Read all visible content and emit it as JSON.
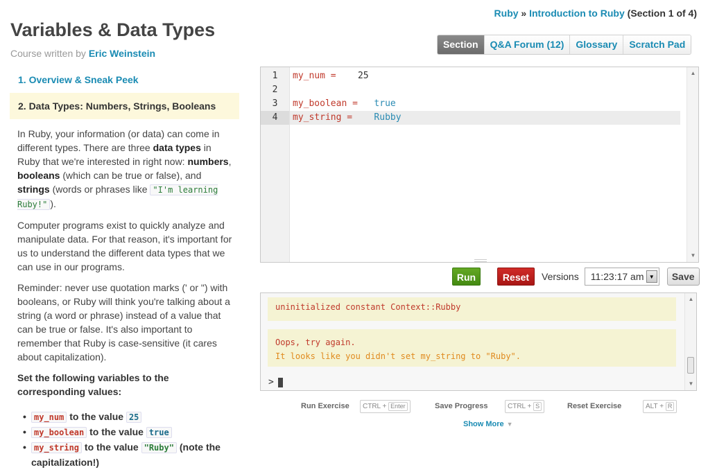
{
  "breadcrumb": {
    "course": "Ruby",
    "sep": " » ",
    "lesson": "Introduction to Ruby",
    "section": " (Section 1 of 4)"
  },
  "page": {
    "title": "Variables & Data Types",
    "author_prefix": "Course written by ",
    "author": "Eric Weinstein"
  },
  "tabs": [
    {
      "label": "Section"
    },
    {
      "label": "Q&A Forum (12)"
    },
    {
      "label": "Glossary"
    },
    {
      "label": "Scratch Pad"
    }
  ],
  "sections": {
    "one": "1. Overview & Sneak Peek",
    "two": "2. Data Types: Numbers, Strings, Booleans"
  },
  "instructions": {
    "p1": {
      "a": "In Ruby, your information (or data) can come in different types. There are three ",
      "b": "data types",
      "c": " in Ruby that we're interested in right now: ",
      "d": "numbers",
      "e": ", ",
      "f": "booleans",
      "g": " (which can be true or false), and ",
      "h": "strings",
      "i": " (words or phrases like ",
      "code": "\"I'm learning Ruby!\"",
      "j": ")."
    },
    "p2": "Computer programs exist to quickly analyze and manipulate data. For that reason, it's important for us to understand the different data types that we can use in our programs.",
    "p3": "Reminder: never use quotation marks (' or \") with booleans, or Ruby will think you're talking about a string (a word or phrase) instead of a value that can be true or false. It's also important to remember that Ruby is case-sensitive (it cares about capitalization).",
    "task": "Set the following variables to the corresponding values:",
    "items": [
      {
        "var": "my_num",
        "mid": " to the value ",
        "val": "25",
        "tail": ""
      },
      {
        "var": "my_boolean",
        "mid": " to the value ",
        "val": "true",
        "tail": ""
      },
      {
        "var": "my_string",
        "mid": " to the value ",
        "val": "\"Ruby\"",
        "tail": " (note the capitalization!)"
      }
    ]
  },
  "editor": {
    "line_numbers": [
      "1",
      "2",
      "3",
      "4"
    ],
    "lines": [
      {
        "name": "my_num",
        "op": " =    ",
        "value": "25"
      },
      {
        "name": "",
        "op": "",
        "value": ""
      },
      {
        "name": "my_boolean",
        "op": " =   ",
        "value": "true"
      },
      {
        "name": "my_string",
        "op": " =    ",
        "value": "Rubby"
      }
    ]
  },
  "controls": {
    "run": "Run",
    "reset": "Reset",
    "versions_label": "Versions",
    "version_selected": "11:23:17 am",
    "save": "Save"
  },
  "console": {
    "error": "uninitialized constant Context::Rubby",
    "oops": "Oops, try again.",
    "hint": "It looks like you didn't set my_string to \"Ruby\".",
    "prompt": ">"
  },
  "shortcuts": {
    "run_label": "Run Exercise",
    "run_mod": "CTRL + ",
    "run_key": "Enter",
    "save_label": "Save Progress",
    "save_mod": "CTRL + ",
    "save_key": "S",
    "reset_label": "Reset Exercise",
    "reset_mod": "ALT + ",
    "reset_key": "R"
  },
  "show_more": "Show More",
  "colors": {
    "link": "#1a8bb3",
    "run": "#64a824",
    "reset": "#c0392b",
    "highlight": "#fdf8dc"
  }
}
